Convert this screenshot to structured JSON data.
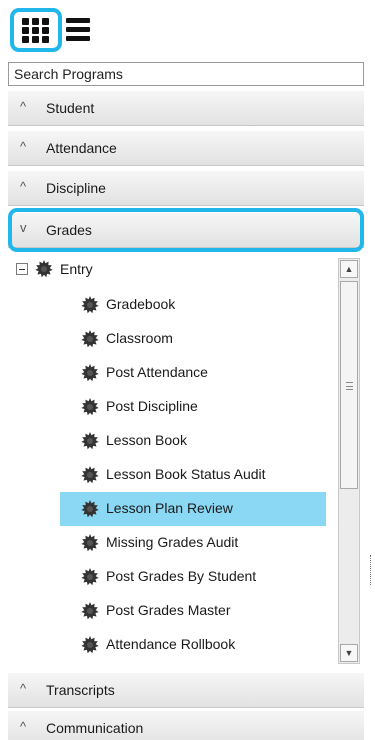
{
  "search": {
    "placeholder": "Search Programs"
  },
  "sections_top": [
    {
      "label": "Student",
      "chevron": "^"
    },
    {
      "label": "Attendance",
      "chevron": "^"
    },
    {
      "label": "Discipline",
      "chevron": "^"
    }
  ],
  "grades": {
    "label": "Grades",
    "chevron": "v"
  },
  "tree": {
    "root_label": "Entry",
    "items": [
      "Gradebook",
      "Classroom",
      "Post Attendance",
      "Post Discipline",
      "Lesson Book",
      "Lesson Book Status Audit",
      "Lesson Plan Review",
      "Missing Grades Audit",
      "Post Grades By Student",
      "Post Grades Master",
      "Attendance Rollbook"
    ],
    "selected_item": "Lesson Plan Review",
    "selected_color": "#8ad8f4"
  },
  "sections_bottom": [
    {
      "label": "Transcripts",
      "chevron": "^"
    },
    {
      "label": "Communication",
      "chevron": "^"
    }
  ],
  "scrollbar": {
    "up_icon": "▲",
    "down_icon": "▼"
  },
  "colors": {
    "highlight": "#21b7ea"
  }
}
